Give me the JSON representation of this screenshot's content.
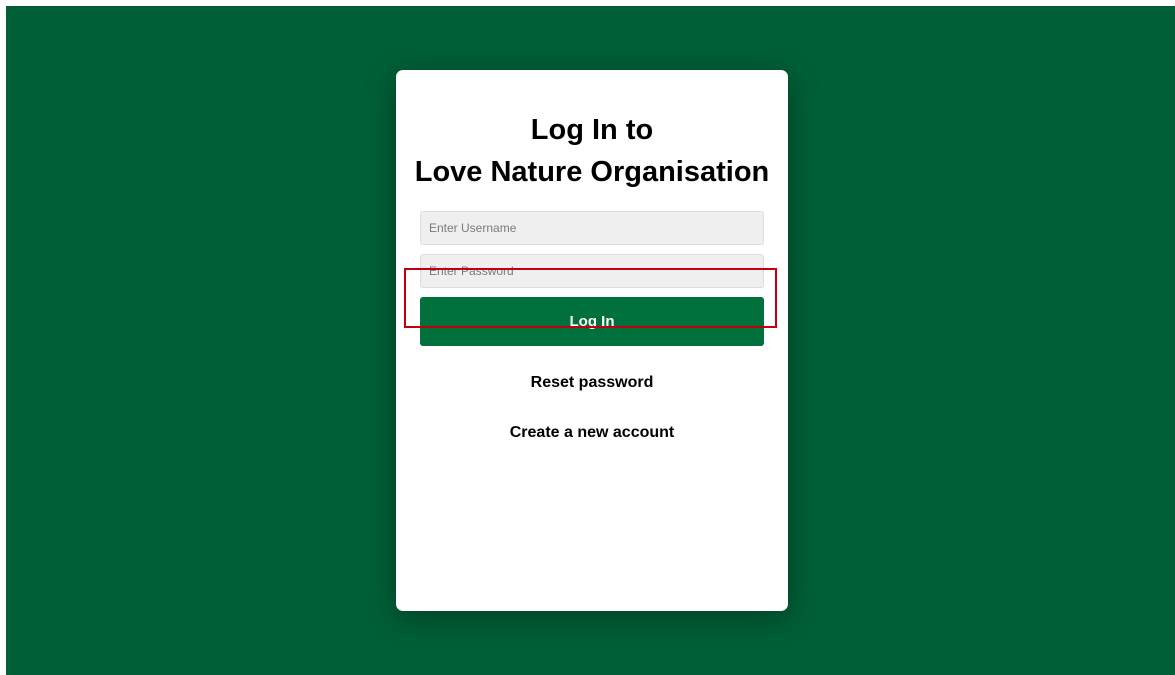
{
  "page": {
    "background_color": "#005f36",
    "accent_color": "#00703c",
    "highlight_color": "#c0000f"
  },
  "login": {
    "title_line1": "Log In to",
    "title_line2": "Love Nature Organisation",
    "username_placeholder": "Enter Username",
    "password_placeholder": "Enter Password",
    "login_button_label": "Log In",
    "reset_password_label": "Reset password",
    "create_account_label": "Create a new account"
  }
}
